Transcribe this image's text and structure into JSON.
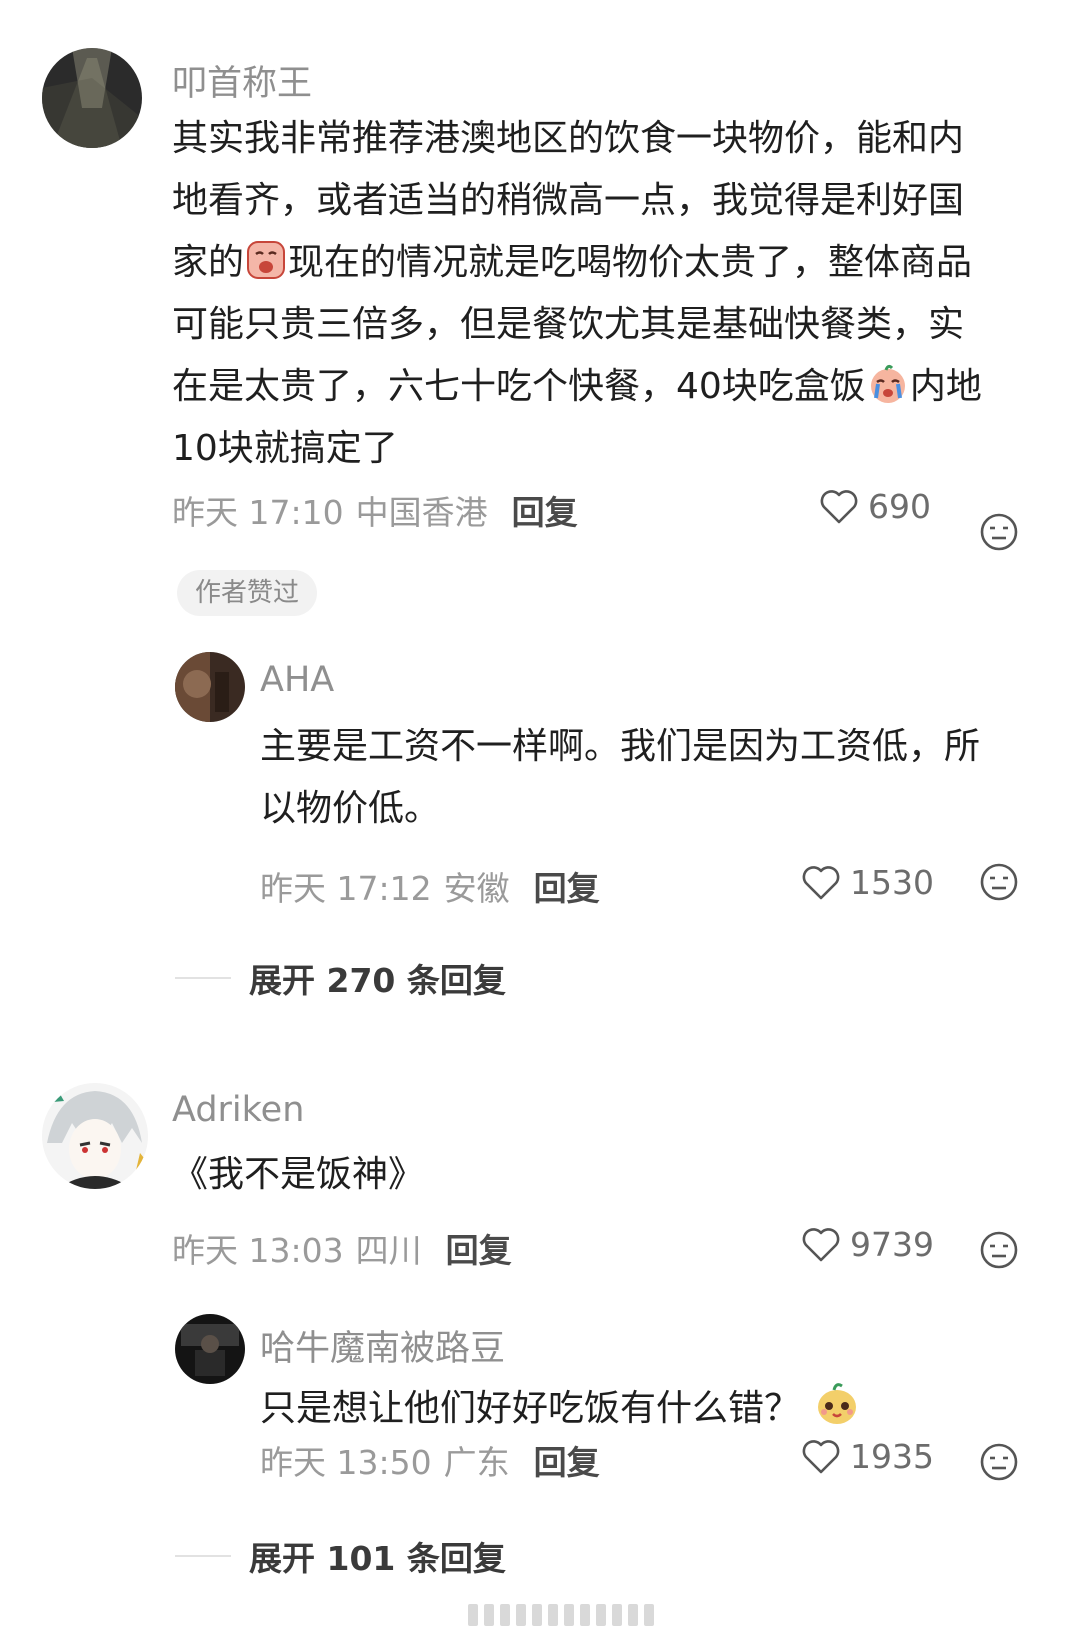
{
  "comments": [
    {
      "username": "叩首称王",
      "text_part1": "其实我非常推荐港澳地区的饮食一块物价，能和内地看齐，或者适当的稍微高一点，我觉得是利好国家的",
      "text_part2": "现在的情况就是吃喝物价太贵了，整体商品可能只贵三倍多，但是餐饮尤其是基础快餐类，实在是太贵了，六七十吃个快餐，40块吃盒饭",
      "text_part3": "内地10块就搞定了",
      "time": "昨天 17:10",
      "location": "中国香港",
      "reply_label": "回复",
      "likes": "690",
      "badge": "作者赞过",
      "replies": [
        {
          "username": "AHA",
          "text": "主要是工资不一样啊。我们是因为工资低，所以物价低。",
          "time": "昨天 17:12",
          "location": "安徽",
          "reply_label": "回复",
          "likes": "1530"
        }
      ],
      "expand_label": "展开 270 条回复"
    },
    {
      "username": "Adriken",
      "text": "《我不是饭神》",
      "time": "昨天 13:03",
      "location": "四川",
      "reply_label": "回复",
      "likes": "9739",
      "replies": [
        {
          "username": "哈牛魔南被路豆",
          "text": "只是想让他们好好吃饭有什么错？",
          "time": "昨天 13:50",
          "location": "广东",
          "reply_label": "回复",
          "likes": "1935"
        }
      ],
      "expand_label": "展开 101 条回复"
    }
  ],
  "icons": {
    "like": "heart-outline-icon",
    "more": "face-neutral-icon",
    "emoji_1": "crying-face-emoji",
    "emoji_2": "sobbing-face-emoji",
    "emoji_3": "smiling-bean-emoji"
  },
  "colors": {
    "username": "#8f8f8f",
    "meta": "#9a9a9a",
    "text": "#1f1f1f",
    "badge_bg": "#f2f2f2"
  }
}
